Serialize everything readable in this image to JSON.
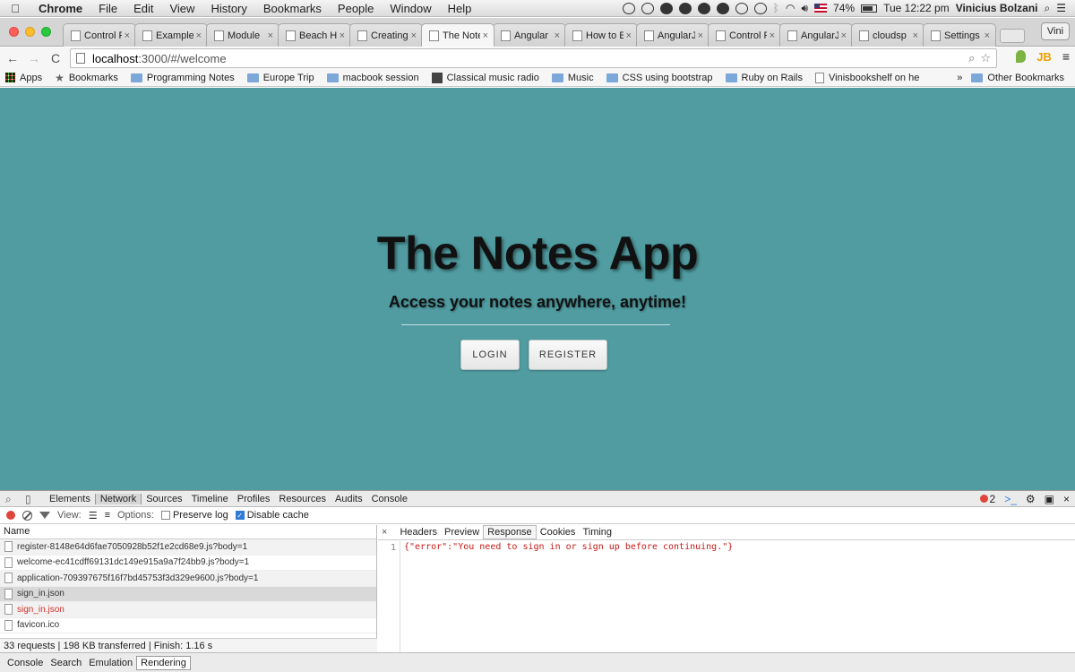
{
  "menubar": {
    "items": [
      "Chrome",
      "File",
      "Edit",
      "View",
      "History",
      "Bookmarks",
      "People",
      "Window",
      "Help"
    ],
    "battery": "74%",
    "clock": "Tue 12:22 pm",
    "user": "Vinicius Bolzani"
  },
  "tabs": [
    {
      "title": "Control F",
      "active": false
    },
    {
      "title": "Example",
      "active": false
    },
    {
      "title": "Module",
      "active": false
    },
    {
      "title": "Beach H",
      "active": false
    },
    {
      "title": "Creating",
      "active": false
    },
    {
      "title": "The Note",
      "active": true
    },
    {
      "title": "Angular",
      "active": false
    },
    {
      "title": "How to E",
      "active": false
    },
    {
      "title": "AngularJ",
      "active": false
    },
    {
      "title": "Control F",
      "active": false
    },
    {
      "title": "AngularJ",
      "active": false
    },
    {
      "title": "cloudsp",
      "active": false
    },
    {
      "title": "Settings",
      "active": false
    }
  ],
  "profile_label": "Vini",
  "address": {
    "host": "localhost",
    "rest": ":3000/#/welcome"
  },
  "bookmarks": {
    "items": [
      "Apps",
      "Bookmarks",
      "Programming Notes",
      "Europe Trip",
      "macbook session",
      "Classical music radio",
      "Music",
      "CSS using bootstrap",
      "Ruby on Rails",
      "Vinisbookshelf on he"
    ],
    "overflow": "»",
    "other": "Other Bookmarks"
  },
  "page": {
    "title": "The Notes App",
    "subtitle": "Access your notes anywhere, anytime!",
    "login_label": "LOGIN",
    "register_label": "REGISTER",
    "background": "#509ca1"
  },
  "devtools": {
    "tabs": [
      "Elements",
      "Network",
      "Sources",
      "Timeline",
      "Profiles",
      "Resources",
      "Audits",
      "Console"
    ],
    "active_tab": "Network",
    "error_count": "2",
    "view_label": "View:",
    "options_label": "Options:",
    "preserve_log": "Preserve log",
    "disable_cache": "Disable cache",
    "name_header": "Name",
    "requests": [
      {
        "name": "register-8148e64d6fae7050928b52f1e2cd68e9.js?body=1",
        "state": "normal"
      },
      {
        "name": "welcome-ec41cdff69131dc149e915a9a7f24bb9.js?body=1",
        "state": "normal"
      },
      {
        "name": "application-709397675f16f7bd45753f3d329e9600.js?body=1",
        "state": "normal"
      },
      {
        "name": "sign_in.json",
        "state": "selected"
      },
      {
        "name": "sign_in.json",
        "state": "error"
      },
      {
        "name": "favicon.ico",
        "state": "normal"
      }
    ],
    "summary": "33 requests | 198 KB transferred | Finish: 1.16 s",
    "detail_tabs": [
      "Headers",
      "Preview",
      "Response",
      "Cookies",
      "Timing"
    ],
    "active_detail_tab": "Response",
    "response_line_no": "1",
    "response_body": "{\"error\":\"You need to sign in or sign up before continuing.\"}",
    "drawer_tabs": [
      "Console",
      "Search",
      "Emulation",
      "Rendering"
    ],
    "active_drawer_tab": "Rendering",
    "error_color": "#d0332a"
  }
}
